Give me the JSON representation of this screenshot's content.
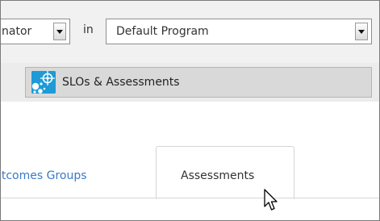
{
  "filter": {
    "role_value": "nator",
    "in_label": "in",
    "program_value": "Default Program"
  },
  "menu": {
    "item_label": "SLOs & Assessments",
    "icon": "bubbles-target-icon"
  },
  "tabs": [
    {
      "label": "utcomes Groups",
      "active": false
    },
    {
      "label": "Assessments",
      "active": true
    }
  ],
  "colors": {
    "link": "#3a79c8",
    "icon_bg": "#1e9ad6"
  }
}
